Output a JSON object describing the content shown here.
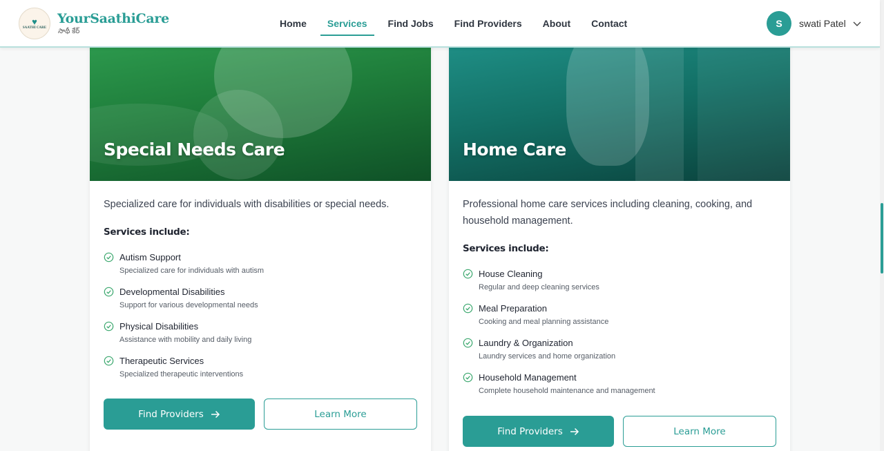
{
  "header": {
    "brand_name": "YourSaathiCare",
    "brand_sub": "సాథీ కేర్",
    "logo_text": "SAATHI CARE",
    "nav": [
      "Home",
      "Services",
      "Find Jobs",
      "Find Providers",
      "About",
      "Contact"
    ],
    "active_nav": "Services",
    "user": {
      "initial": "S",
      "name": "swati Patel"
    }
  },
  "cards": [
    {
      "title": "Special Needs Care",
      "description": "Specialized care for individuals with disabilities or special needs.",
      "includes_label": "Services include:",
      "services": [
        {
          "name": "Autism Support",
          "desc": "Specialized care for individuals with autism"
        },
        {
          "name": "Developmental Disabilities",
          "desc": "Support for various developmental needs"
        },
        {
          "name": "Physical Disabilities",
          "desc": "Assistance with mobility and daily living"
        },
        {
          "name": "Therapeutic Services",
          "desc": "Specialized therapeutic interventions"
        }
      ],
      "primary_button": "Find Providers",
      "secondary_button": "Learn More",
      "hero_color": "#1e7c3a"
    },
    {
      "title": "Home Care",
      "description": "Professional home care services including cleaning, cooking, and household management.",
      "includes_label": "Services include:",
      "services": [
        {
          "name": "House Cleaning",
          "desc": "Regular and deep cleaning services"
        },
        {
          "name": "Meal Preparation",
          "desc": "Cooking and meal planning assistance"
        },
        {
          "name": "Laundry & Organization",
          "desc": "Laundry services and home organization"
        },
        {
          "name": "Household Management",
          "desc": "Complete household maintenance and management"
        }
      ],
      "primary_button": "Find Providers",
      "secondary_button": "Learn More",
      "hero_color": "#137066"
    }
  ],
  "colors": {
    "accent": "#2a9d95",
    "check": "#3aa76d"
  },
  "icons": {
    "check": "check-circle-icon",
    "arrow": "arrow-right-icon",
    "chevron": "chevron-down-icon"
  }
}
